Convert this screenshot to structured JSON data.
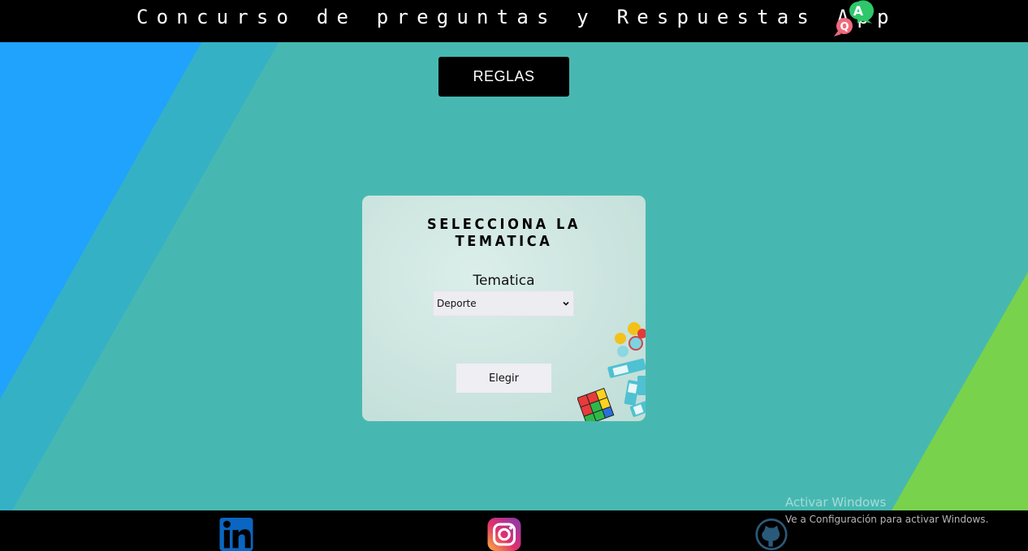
{
  "header": {
    "title": "Concurso de preguntas y Respuestas App",
    "logo_icon": "qa-chat-icon",
    "logo_letters": [
      "Q",
      "A"
    ]
  },
  "rules_button": {
    "label": "REGLAS"
  },
  "card": {
    "title": "SELECCIONA LA TEMATICA",
    "field_label": "Tematica",
    "select": {
      "selected": "Deporte"
    },
    "submit_label": "Elegir"
  },
  "footer": {
    "links": [
      {
        "icon": "linkedin-icon"
      },
      {
        "icon": "instagram-icon"
      },
      {
        "icon": "github-icon"
      }
    ]
  },
  "watermark": {
    "title": "Activar Windows",
    "subtitle": "Ve a Configuración para activar Windows."
  },
  "colors": {
    "background_teal": "#47b8b1",
    "stripe_blue": "#1fa3fc",
    "stripe_mid": "#35b1c6",
    "corner_green": "#78d24c",
    "bars": "#000000"
  }
}
